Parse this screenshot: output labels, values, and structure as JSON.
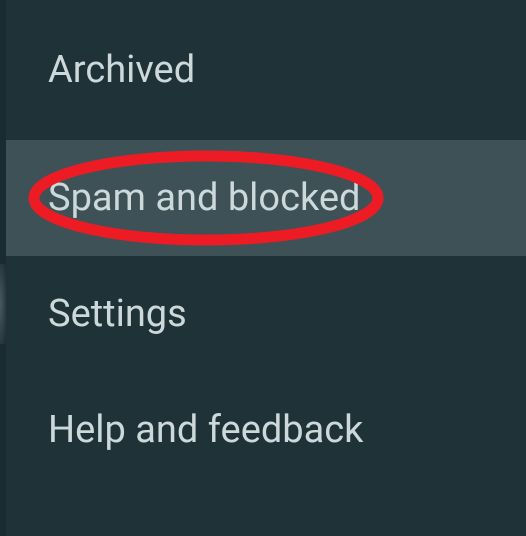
{
  "menu": {
    "items": [
      {
        "label": "Archived",
        "selected": false
      },
      {
        "label": "Spam and blocked",
        "selected": true,
        "highlighted": true
      },
      {
        "label": "Settings",
        "selected": false
      },
      {
        "label": "Help and feedback",
        "selected": false
      }
    ]
  },
  "highlight": {
    "color": "#ed1c24"
  }
}
